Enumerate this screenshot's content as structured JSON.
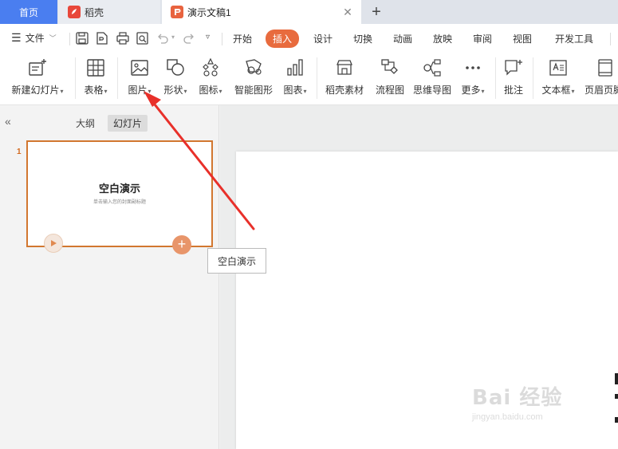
{
  "tabs": {
    "home": "首页",
    "daoke": "稻壳",
    "doc": "演示文稿1"
  },
  "menu": {
    "file": "文件",
    "tabs": [
      "开始",
      "插入",
      "设计",
      "切换",
      "动画",
      "放映",
      "审阅",
      "视图",
      "开发工具"
    ],
    "active_tab": "插入"
  },
  "ribbon": {
    "new_slide": "新建幻灯片",
    "table": "表格",
    "picture": "图片",
    "shape": "形状",
    "icon": "图标",
    "smart_graphic": "智能图形",
    "chart": "图表",
    "daoke_material": "稻壳素材",
    "flowchart": "流程图",
    "mindmap": "思维导图",
    "more": "更多",
    "comment": "批注",
    "textbox": "文本框",
    "header_footer": "页眉页脚"
  },
  "left_panel": {
    "outline_tab": "大纲",
    "slides_tab": "幻灯片",
    "slide_number": "1",
    "thumb_title": "空白演示",
    "thumb_subtitle": "单击输入您的封面副标题"
  },
  "tooltip": "空白演示",
  "watermark": {
    "main": "Bai 经验",
    "url": "jingyan.baidu.com"
  },
  "colors": {
    "accent_orange": "#e86b3e",
    "home_tab_blue": "#4a7ef0",
    "annotation_red": "#e8302a"
  }
}
